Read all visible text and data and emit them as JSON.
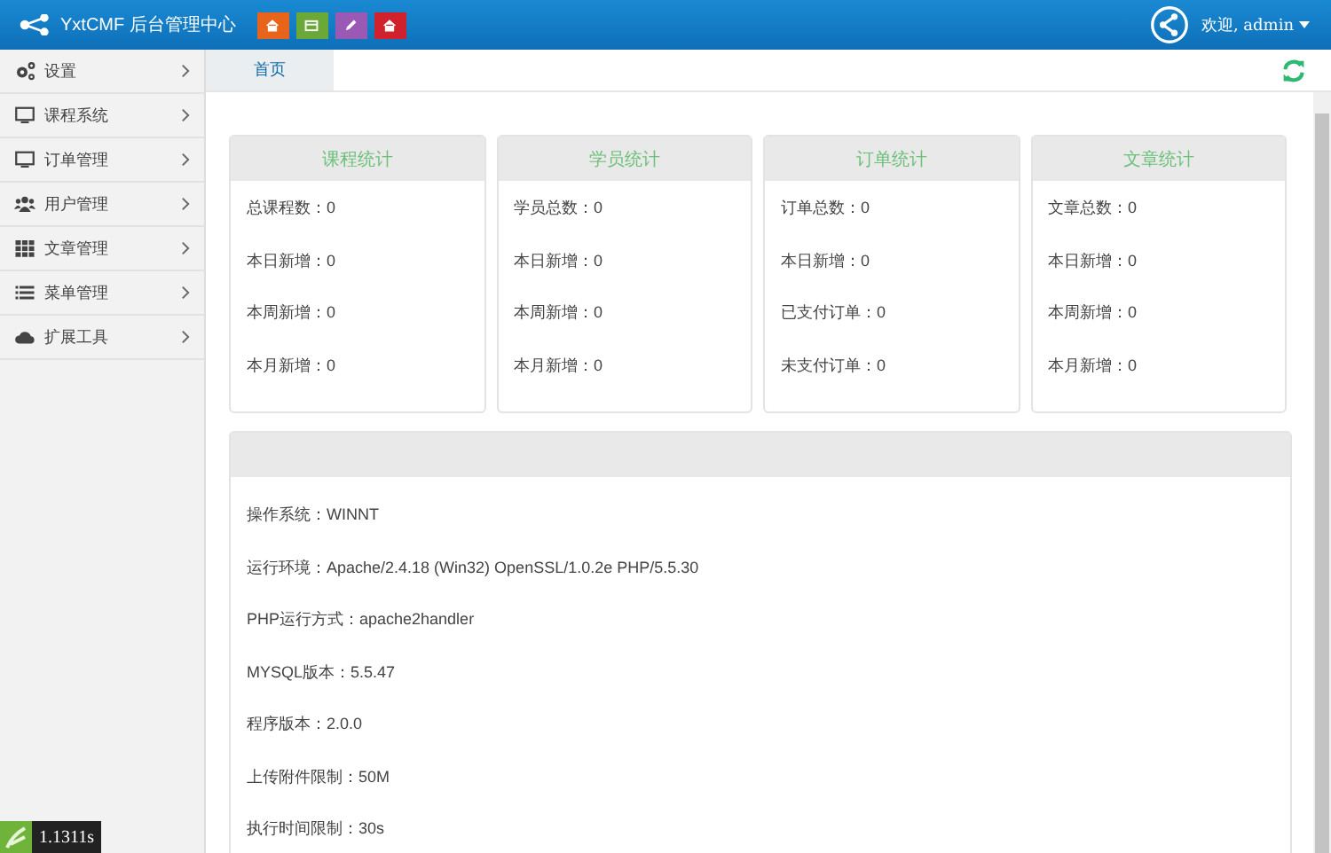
{
  "header": {
    "brand": "YxtCMF 后台管理中心",
    "quick_buttons": [
      {
        "color": "#e8641b"
      },
      {
        "color": "#6aa837"
      },
      {
        "color": "#9b59b6"
      },
      {
        "color": "#d0212d"
      }
    ],
    "user": "欢迎, admin"
  },
  "sidebar": {
    "items": [
      {
        "label": "设置"
      },
      {
        "label": "课程系统"
      },
      {
        "label": "订单管理"
      },
      {
        "label": "用户管理"
      },
      {
        "label": "文章管理"
      },
      {
        "label": "菜单管理"
      },
      {
        "label": "扩展工具"
      }
    ]
  },
  "tabs": [
    {
      "label": "首页",
      "selected": true
    }
  ],
  "stat_cards": [
    {
      "title": "课程统计",
      "lines": [
        "总课程数：0",
        "本日新增：0",
        "本周新增：0",
        "本月新增：0"
      ]
    },
    {
      "title": "学员统计",
      "lines": [
        "学员总数：0",
        "本日新增：0",
        "本周新增：0",
        "本月新增：0"
      ]
    },
    {
      "title": "订单统计",
      "lines": [
        "订单总数：0",
        "本日新增：0",
        "已支付订单：0",
        "未支付订单：0"
      ]
    },
    {
      "title": "文章统计",
      "lines": [
        "文章总数：0",
        "本日新增：0",
        "本周新增：0",
        "本月新增：0"
      ]
    }
  ],
  "system_info": {
    "lines": [
      "操作系统：WINNT",
      "运行环境：Apache/2.4.18 (Win32) OpenSSL/1.0.2e PHP/5.5.30",
      "PHP运行方式：apache2handler",
      "MYSQL版本：5.5.47",
      "程序版本：2.0.0",
      "上传附件限制：50M",
      "执行时间限制：30s"
    ]
  },
  "debug_bar": {
    "time": "1.1311s"
  }
}
